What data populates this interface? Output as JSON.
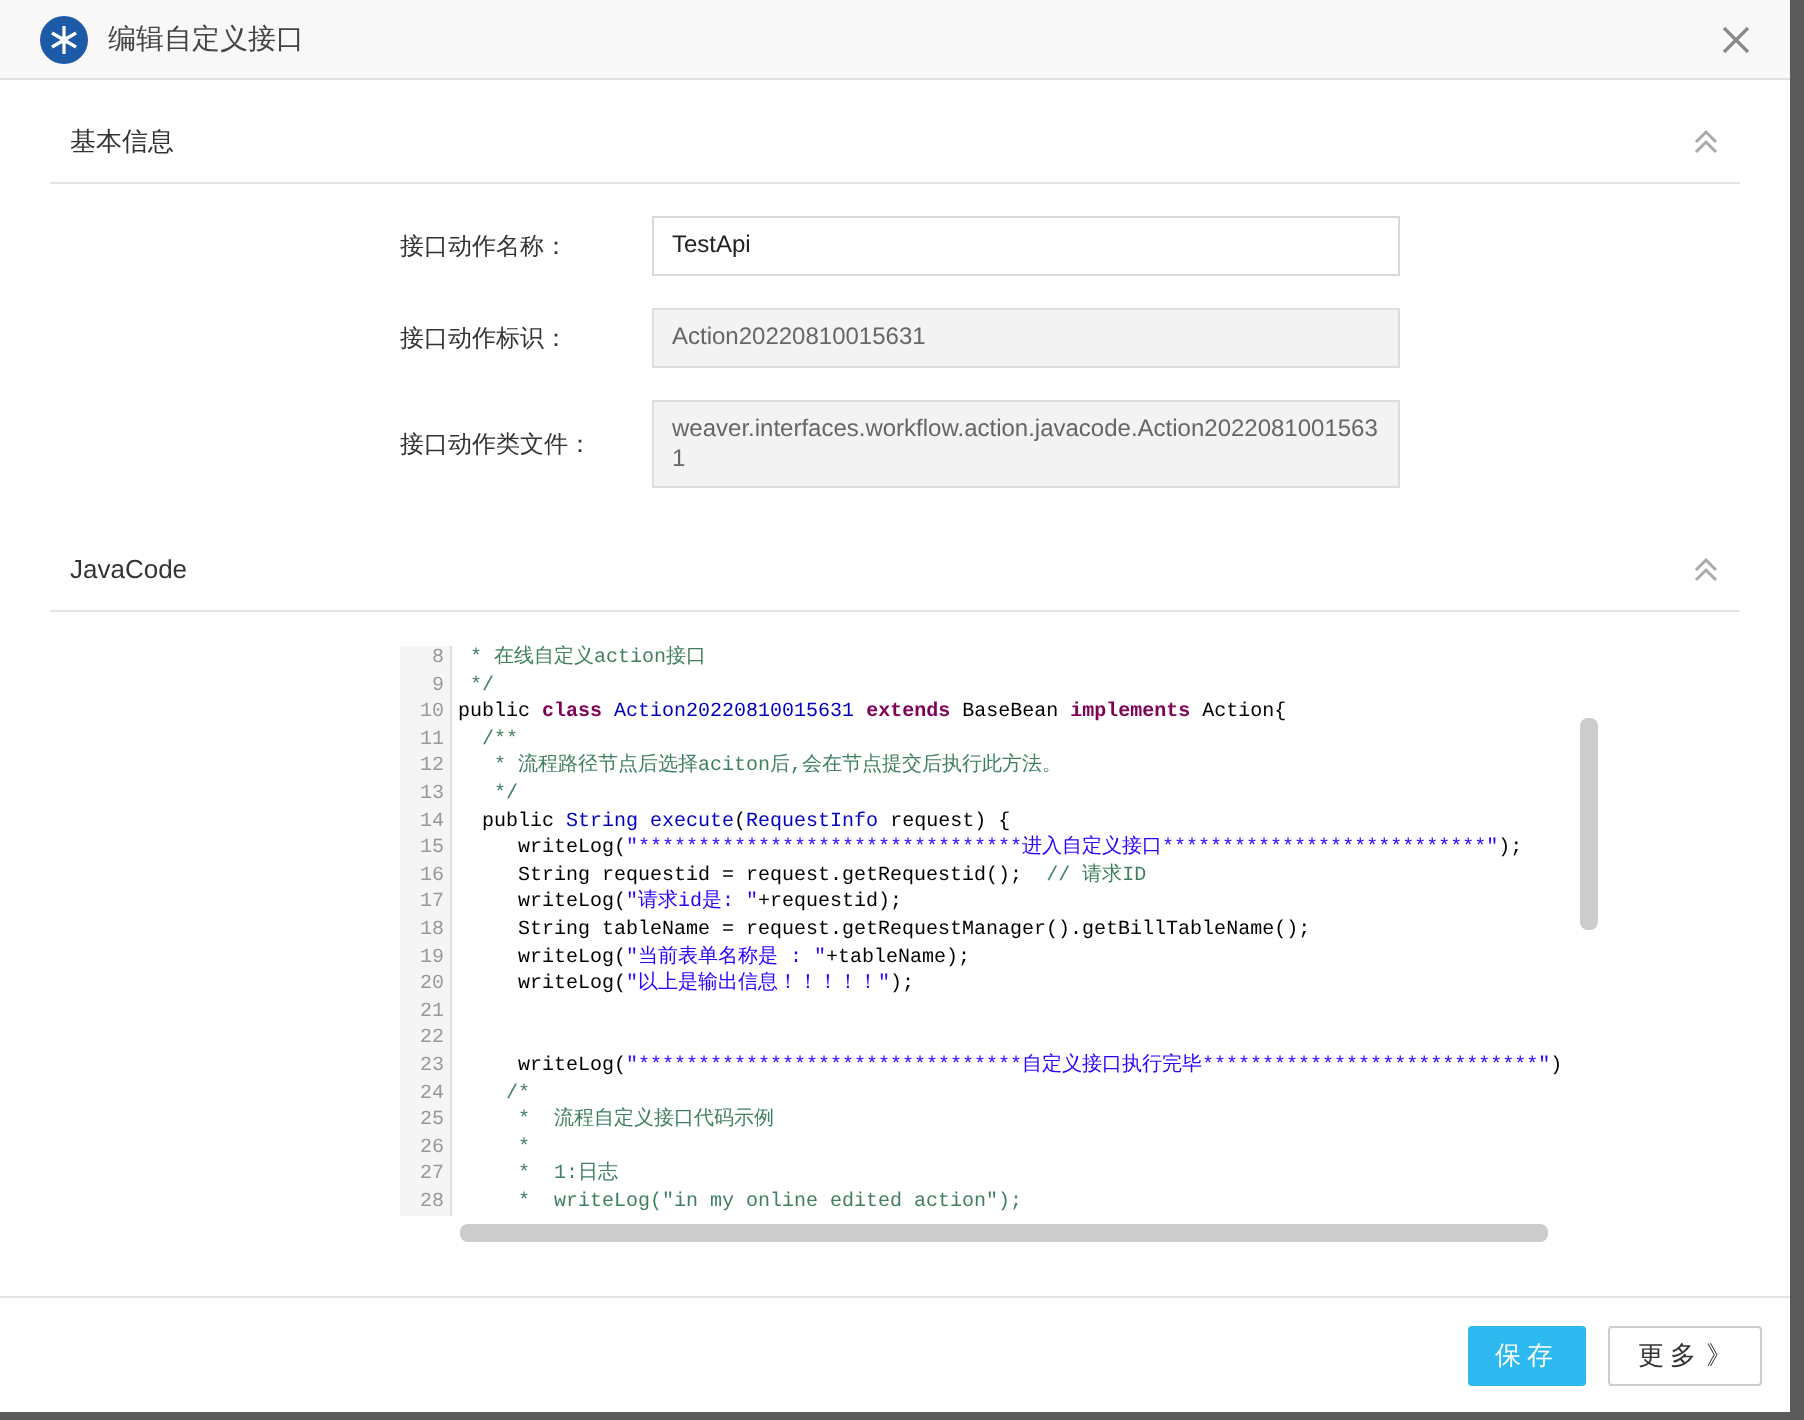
{
  "dialog": {
    "title": "编辑自定义接口"
  },
  "basic_section": {
    "title": "基本信息",
    "expanded": true
  },
  "fields": [
    {
      "label": "接口动作名称：",
      "value": "TestApi",
      "disabled": false
    },
    {
      "label": "接口动作标识：",
      "value": "Action20220810015631",
      "disabled": true
    },
    {
      "label": "接口动作类文件：",
      "value": "weaver.interfaces.workflow.action.javacode.Action20220810015631",
      "disabled": true
    }
  ],
  "code_section": {
    "title": "JavaCode",
    "expanded": true
  },
  "code_lines": [
    {
      "number": "8",
      "tokens": [
        {
          "kind": "comment",
          "text": " * 在线自定义action接口"
        }
      ]
    },
    {
      "number": "9",
      "tokens": [
        {
          "kind": "comment",
          "text": " */"
        }
      ]
    },
    {
      "number": "10",
      "tokens": [
        {
          "kind": "plain",
          "text": "public "
        },
        {
          "kind": "keyword",
          "text": "class"
        },
        {
          "kind": "type",
          "text": " Action20220810015631 "
        },
        {
          "kind": "keyword",
          "text": "extends"
        },
        {
          "kind": "plain",
          "text": " BaseBean "
        },
        {
          "kind": "keyword",
          "text": "implements"
        },
        {
          "kind": "plain",
          "text": " Action{"
        }
      ]
    },
    {
      "number": "11",
      "tokens": [
        {
          "kind": "comment",
          "text": "  /**"
        }
      ]
    },
    {
      "number": "12",
      "tokens": [
        {
          "kind": "comment",
          "text": "   * 流程路径节点后选择aciton后,会在节点提交后执行此方法。"
        }
      ]
    },
    {
      "number": "13",
      "tokens": [
        {
          "kind": "comment",
          "text": "   */"
        }
      ]
    },
    {
      "number": "14",
      "tokens": [
        {
          "kind": "plain",
          "text": "  public "
        },
        {
          "kind": "type",
          "text": "String execute"
        },
        {
          "kind": "plain",
          "text": "("
        },
        {
          "kind": "type",
          "text": "RequestInfo"
        },
        {
          "kind": "plain",
          "text": " request) {"
        }
      ]
    },
    {
      "number": "15",
      "tokens": [
        {
          "kind": "plain",
          "text": "     writeLog("
        },
        {
          "kind": "string",
          "text": "\"********************************进入自定义接口***************************\""
        },
        {
          "kind": "plain",
          "text": ");"
        }
      ]
    },
    {
      "number": "16",
      "tokens": [
        {
          "kind": "plain",
          "text": "     String requestid = request.getRequestid();  "
        },
        {
          "kind": "comment",
          "text": "// 请求ID"
        }
      ]
    },
    {
      "number": "17",
      "tokens": [
        {
          "kind": "plain",
          "text": "     writeLog("
        },
        {
          "kind": "string",
          "text": "\"请求id是: \""
        },
        {
          "kind": "plain",
          "text": "+requestid);"
        }
      ]
    },
    {
      "number": "18",
      "tokens": [
        {
          "kind": "plain",
          "text": "     String tableName = request.getRequestManager().getBillTableName();"
        }
      ]
    },
    {
      "number": "19",
      "tokens": [
        {
          "kind": "plain",
          "text": "     writeLog("
        },
        {
          "kind": "string",
          "text": "\"当前表单名称是 : \""
        },
        {
          "kind": "plain",
          "text": "+tableName);"
        }
      ]
    },
    {
      "number": "20",
      "tokens": [
        {
          "kind": "plain",
          "text": "     writeLog("
        },
        {
          "kind": "string",
          "text": "\"以上是输出信息！！！！！\""
        },
        {
          "kind": "plain",
          "text": ");"
        }
      ]
    },
    {
      "number": "21"
    },
    {
      "number": "22"
    },
    {
      "number": "23",
      "tokens": [
        {
          "kind": "plain",
          "text": "     writeLog("
        },
        {
          "kind": "string",
          "text": "\"********************************自定义接口执行完毕****************************\""
        },
        {
          "kind": "plain",
          "text": ")"
        }
      ]
    },
    {
      "number": "24",
      "tokens": [
        {
          "kind": "comment",
          "text": "    /*"
        }
      ]
    },
    {
      "number": "25",
      "tokens": [
        {
          "kind": "comment",
          "text": "     *  流程自定义接口代码示例"
        }
      ]
    },
    {
      "number": "26",
      "tokens": [
        {
          "kind": "comment",
          "text": "     *"
        }
      ]
    },
    {
      "number": "27",
      "tokens": [
        {
          "kind": "comment",
          "text": "     *  1:日志"
        }
      ]
    },
    {
      "number": "28",
      "tokens": [
        {
          "kind": "comment",
          "text": "     *  writeLog(\"in my online edited action\");"
        }
      ]
    }
  ],
  "buttons": [
    {
      "label": "保存",
      "kind": "primary"
    },
    {
      "label": "更多",
      "kind": "more",
      "icon": "》"
    }
  ]
}
